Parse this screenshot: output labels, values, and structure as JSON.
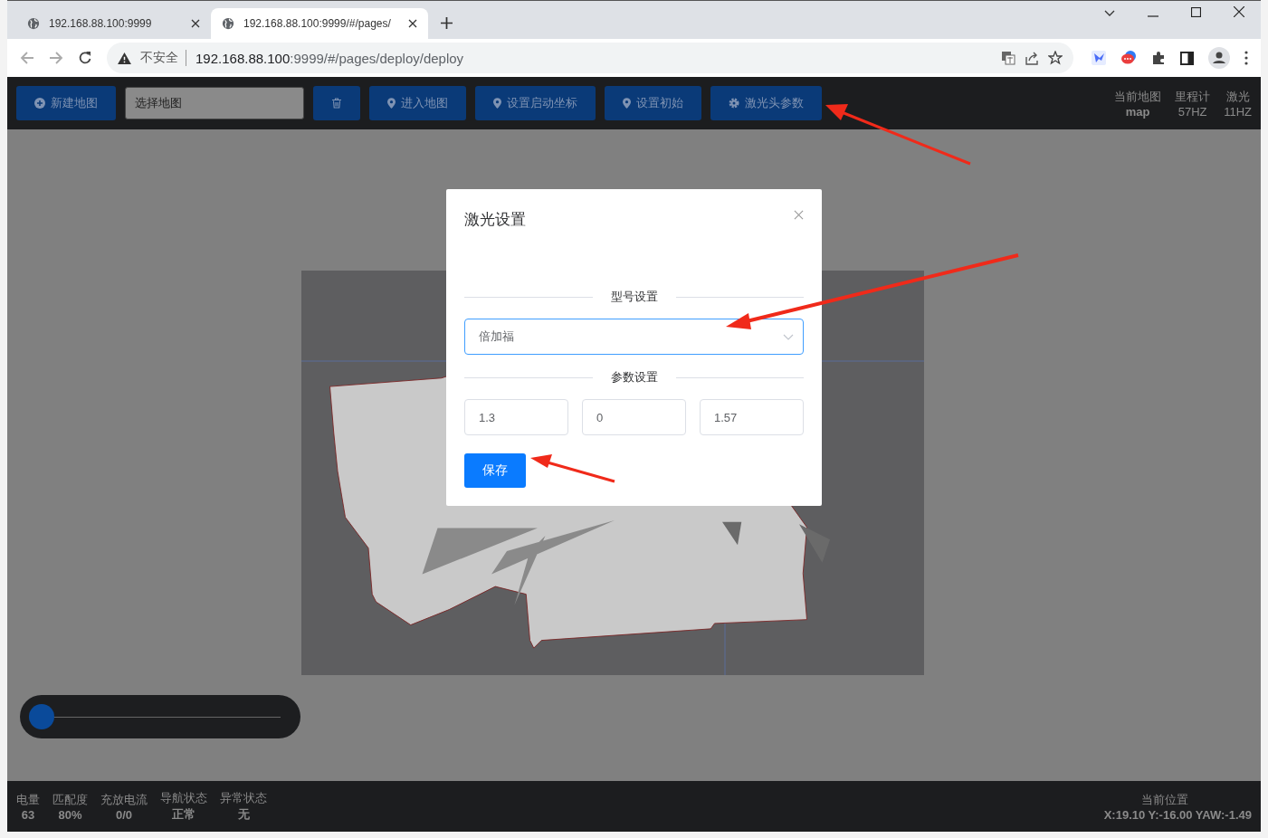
{
  "browser": {
    "tabs": [
      {
        "title": "192.168.88.100:9999",
        "selected": false
      },
      {
        "title": "192.168.88.100:9999/#/pages/",
        "selected": true
      }
    ],
    "security": "不安全",
    "url_host": "192.168.88.100",
    "url_rest": ":9999/#/pages/deploy/deploy"
  },
  "toolbar": [
    {
      "kind": "add_button",
      "label": "新建地图"
    },
    {
      "kind": "map_select",
      "placeholder": "选择地图"
    },
    {
      "kind": "delete_button"
    },
    {
      "kind": "pin_button",
      "label": "进入地图"
    },
    {
      "kind": "pin_button",
      "label": "设置启动坐标"
    },
    {
      "kind": "pin_button",
      "label": "设置初始"
    },
    {
      "kind": "settings_button",
      "label": "激光头参数"
    }
  ],
  "header_stats": [
    {
      "label": "当前地图",
      "value": "map"
    },
    {
      "label": "里程计",
      "value": "57HZ"
    },
    {
      "label": "激光",
      "value": "11HZ"
    }
  ],
  "zoom_slider": {
    "level": 0
  },
  "dialog": {
    "title": "激光设置",
    "model_section": "型号设置",
    "model_value": "倍加福",
    "params_section": "参数设置",
    "params": [
      "1.3",
      "0",
      "1.57"
    ],
    "save": "保存"
  },
  "status_bar": [
    {
      "label": "电量",
      "value": "63"
    },
    {
      "label": "匹配度",
      "value": "80%"
    },
    {
      "label": "充放电流",
      "value": "0/0"
    },
    {
      "label": "导航状态",
      "value": "正常"
    },
    {
      "label": "异常状态",
      "value": "无"
    }
  ],
  "position": {
    "label": "当前位置",
    "value": "X:19.10 Y:-16.00 YAW:-1.49"
  }
}
